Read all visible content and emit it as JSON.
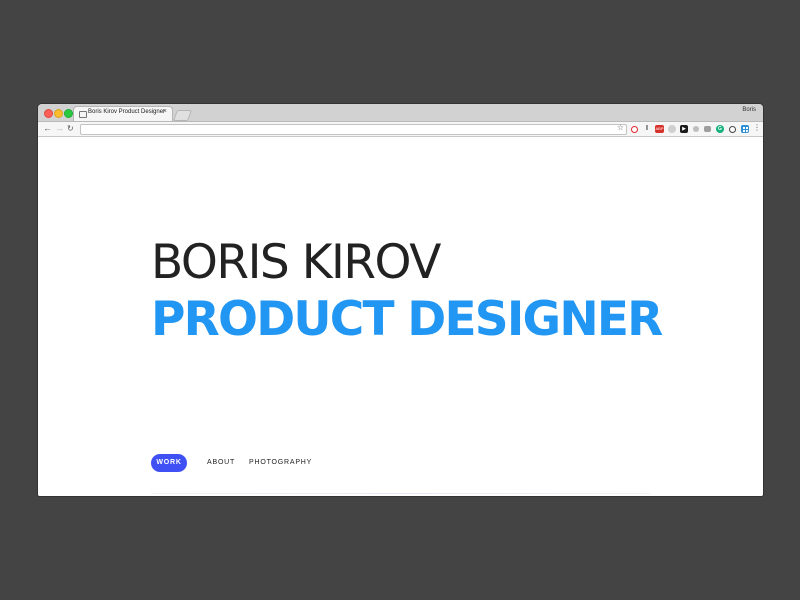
{
  "browser": {
    "tab_title": "Boris Kirov Product Designer",
    "tab_close": "×",
    "profile_name": "Boris",
    "url": "",
    "icons": {
      "back": "←",
      "forward": "→",
      "reload": "↻",
      "star": "☆",
      "menu": "⋮"
    },
    "extensions": [
      {
        "name": "opera-icon",
        "glyph": ""
      },
      {
        "name": "info-icon",
        "glyph": "I"
      },
      {
        "name": "adblock-icon",
        "glyph": "ABP"
      },
      {
        "name": "circle-extension-icon",
        "glyph": ""
      },
      {
        "name": "play-icon",
        "glyph": "▶"
      },
      {
        "name": "gray-extension-icon",
        "glyph": ""
      },
      {
        "name": "camera-icon",
        "glyph": ""
      },
      {
        "name": "grammarly-icon",
        "glyph": "G"
      },
      {
        "name": "block-icon",
        "glyph": ""
      },
      {
        "name": "grid-icon",
        "glyph": ""
      }
    ]
  },
  "hero": {
    "name": "BORIS KIROV",
    "role": "PRODUCT DESIGNER"
  },
  "nav": {
    "work": "WORK",
    "about": "ABOUT",
    "photography": "PHOTOGRAPHY"
  },
  "colors": {
    "accent_blue": "#2196f3",
    "button_blue": "#3f51f4",
    "backdrop": "#444444"
  }
}
